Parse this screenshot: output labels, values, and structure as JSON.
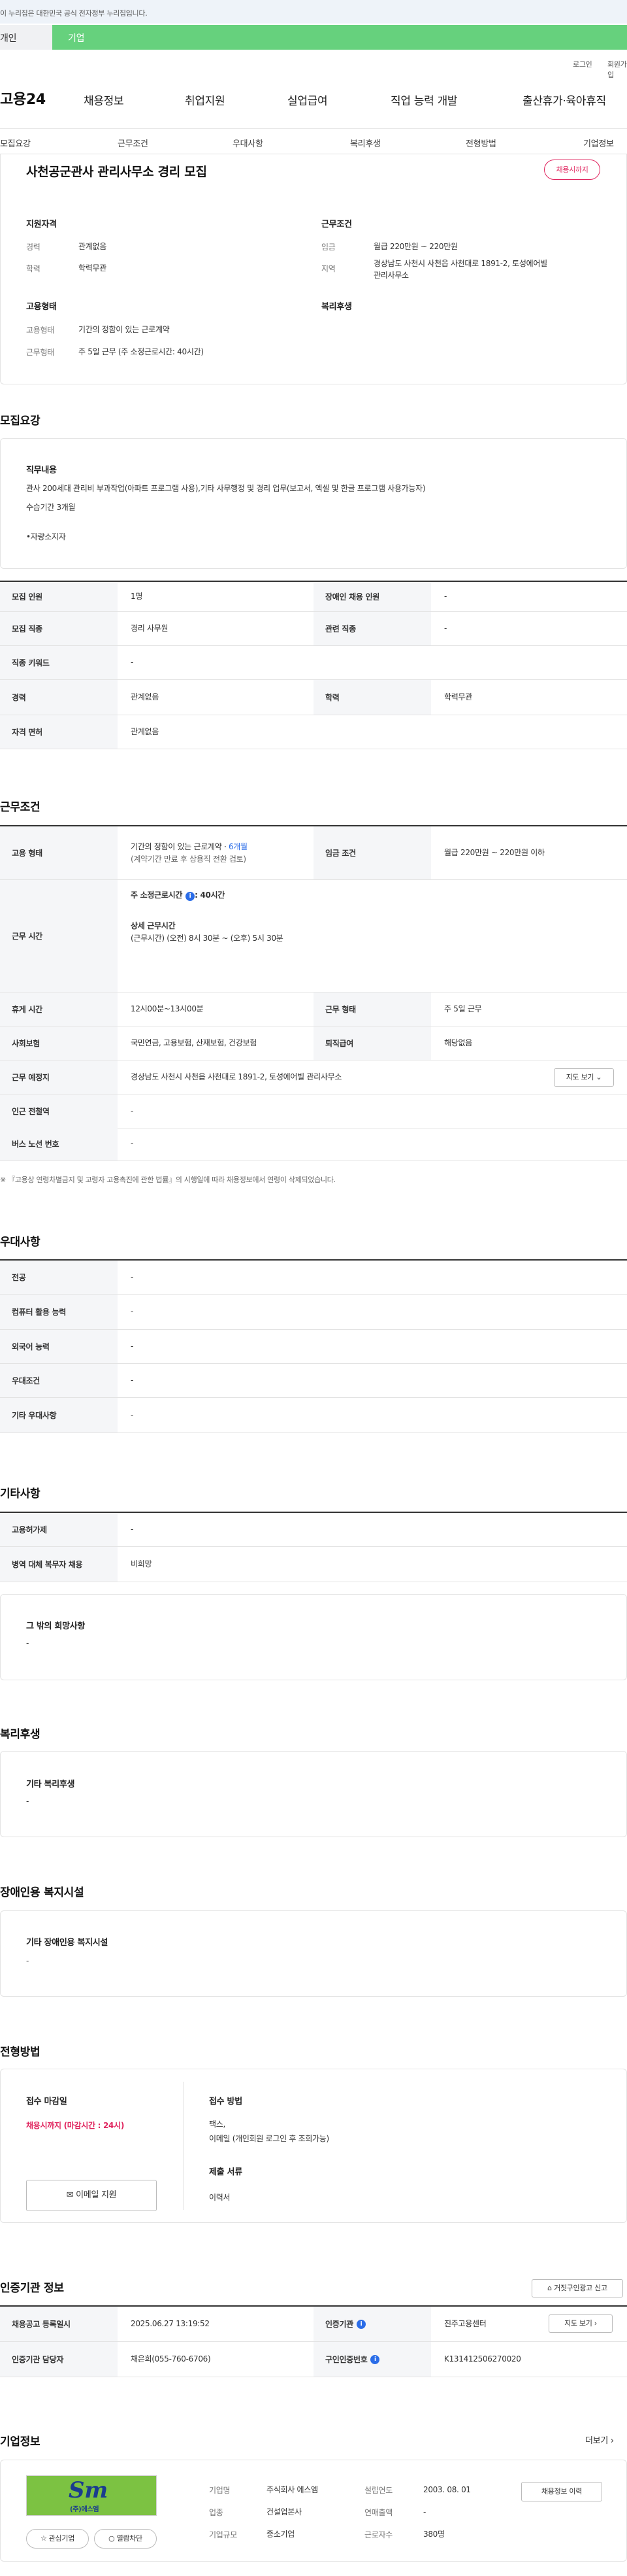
{
  "gov_banner": "이 누리집은 대한민국 공식 전자정부 누리집입니다.",
  "user_toggle": {
    "personal": "개인",
    "corporate": "기업"
  },
  "util": {
    "login": "로그인",
    "join": "회원가입"
  },
  "logo": "고용24",
  "gnb": [
    "채용정보",
    "취업지원",
    "실업급여",
    "직업 능력 개발",
    "출산휴가·육아휴직"
  ],
  "tabs": [
    "모집요강",
    "근무조건",
    "우대사항",
    "복리후생",
    "전형방법",
    "기업정보"
  ],
  "summary": {
    "title": "사천공군관사 관리사무소 경리 모집",
    "badge": "채용시까지",
    "qualification_head": "지원자격",
    "career_label": "경력",
    "career_value": "관계없음",
    "edu_label": "학력",
    "edu_value": "학력무관",
    "condition_head": "근무조건",
    "wage_label": "임금",
    "wage_value": "월급 220만원 ~ 220만원",
    "area_label": "지역",
    "area_value_1": "경상남도 사천시 사천읍 사천대로 1891-2, 토성에어빌",
    "area_value_2": "관리사무소",
    "employ_head": "고용형태",
    "emp_type_label": "고용형태",
    "emp_type_value": "기간의 정함이 있는 근로계약",
    "work_type_label": "근무형태",
    "work_type_value": "주 5일 근무 (주 소정근로시간: 40시간)",
    "welfare_head": "복리후생"
  },
  "recruit": {
    "title": "모집요강",
    "duty_head": "직무내용",
    "duty_line1": "관사 200세대 관리비 부과작업(아파트 프로그램 사용),기타 사무행정 및 경리 업무(보고서, 엑셀 및 한글 프로그램 사용가능자)",
    "duty_line2": "수습기간 3개월",
    "duty_line3": "•자량소지자",
    "rows": [
      [
        "모집 인원",
        "1명",
        "장애인 채용 인원",
        "-"
      ],
      [
        "모집 직종",
        "경리 사무원",
        "관련 직종",
        "-"
      ],
      [
        "직종 키워드",
        "-"
      ],
      [
        "경력",
        "관계없음",
        "학력",
        "학력무관"
      ],
      [
        "자격 면허",
        "관계없음"
      ]
    ]
  },
  "work": {
    "title": "근무조건",
    "employ_label": "고용 형태",
    "employ_line1_a": "기간의 정함이 있는 근로계약 · ",
    "employ_line1_b": "6개월",
    "employ_line2": "(계약기간 만료 후 상용직 전환 검토)",
    "wage_label": "임금 조건",
    "wage_value": "월급 220만원 ~ 220만원 이하",
    "time_label": "근무 시간",
    "time_fixed_head": "주 소정근로시간",
    "time_fixed_value": ": 40시간",
    "time_detail_head": "상세 근무시간",
    "time_detail_value": "(근무시간) (오전) 8시 30분 ~ (오후) 5시 30분",
    "rest_label": "휴게 시간",
    "rest_value": "12시00분~13시00분",
    "worktype_label": "근무 형태",
    "worktype_value": "주 5일 근무",
    "insurance_label": "사회보험",
    "insurance_value": "국민연금, 고용보험, 산재보험, 건강보험",
    "severance_label": "퇴직급여",
    "severance_value": "해당없음",
    "place_label": "근무 예정지",
    "place_value": "경상남도 사천시 사천읍 사천대로 1891-2, 토성에어빌 관리사무소",
    "map_button": "지도 보기",
    "station_label": "인근 전철역",
    "station_value": "-",
    "bus_label": "버스 노선 번호",
    "bus_value": "-",
    "note": "※ 『고용상 연령차별금지 및 고령자 고용촉진에 관한 법률』의 시행일에 따라 채용정보에서 연령이 삭제되었습니다."
  },
  "preference": {
    "title": "우대사항",
    "rows": [
      [
        "전공",
        "-"
      ],
      [
        "컴퓨터 활용 능력",
        "-"
      ],
      [
        "외국어 능력",
        "-"
      ],
      [
        "우대조건",
        "-"
      ],
      [
        "기타 우대사항",
        "-"
      ]
    ]
  },
  "etc": {
    "title": "기타사항",
    "rows": [
      [
        "고용허가제",
        "-"
      ],
      [
        "병역 대체 복무자 채용",
        "비희망"
      ]
    ],
    "hope_head": "그 밖의 희망사항",
    "hope_value": "-"
  },
  "welfare": {
    "title": "복리후생",
    "head": "기타 복리후생",
    "value": "-"
  },
  "disabled": {
    "title": "장애인용 복지시설",
    "head": "기타 장애인용 복지시설",
    "value": "-"
  },
  "selection": {
    "title": "전형방법",
    "deadline_head": "접수 마감일",
    "deadline_value": "채용시까지 (마감시간 : 24시)",
    "email_button": "이메일 지원",
    "method_head": "접수 방법",
    "method_line1": "팩스,",
    "method_line2": "이메일 (개인회원 로그인 후 조회가능)",
    "docs_head": "제출 서류",
    "docs_value": "이력서"
  },
  "cert": {
    "title": "인증기관 정보",
    "report_button": "거짓구인광고 신고",
    "reg_label": "채용공고 등록일시",
    "reg_value": "2025.06.27 13:19:52",
    "org_label": "인증기관",
    "org_value": "진주고용센터",
    "map_button": "지도 보기",
    "manager_label": "인증기관 담당자",
    "manager_value": "채은희(055-760-6706)",
    "number_label": "구인인증번호",
    "number_value": "K131412506270020"
  },
  "company": {
    "title": "기업정보",
    "more": "더보기",
    "logo_text": "Sm",
    "logo_sub": "(주)에스엠",
    "interest_button": "관심기업",
    "block_button": "열람차단",
    "history_button": "채용정보 이력",
    "name_label": "기업명",
    "name_value": "주식회사 에스엠",
    "industry_label": "업종",
    "industry_value": "건설업본사",
    "scale_label": "기업규모",
    "scale_value": "중소기업",
    "founded_label": "설립연도",
    "founded_value": "2003. 08. 01",
    "sales_label": "연매출액",
    "sales_value": "-",
    "staff_label": "근로자수",
    "staff_value": "380명"
  }
}
